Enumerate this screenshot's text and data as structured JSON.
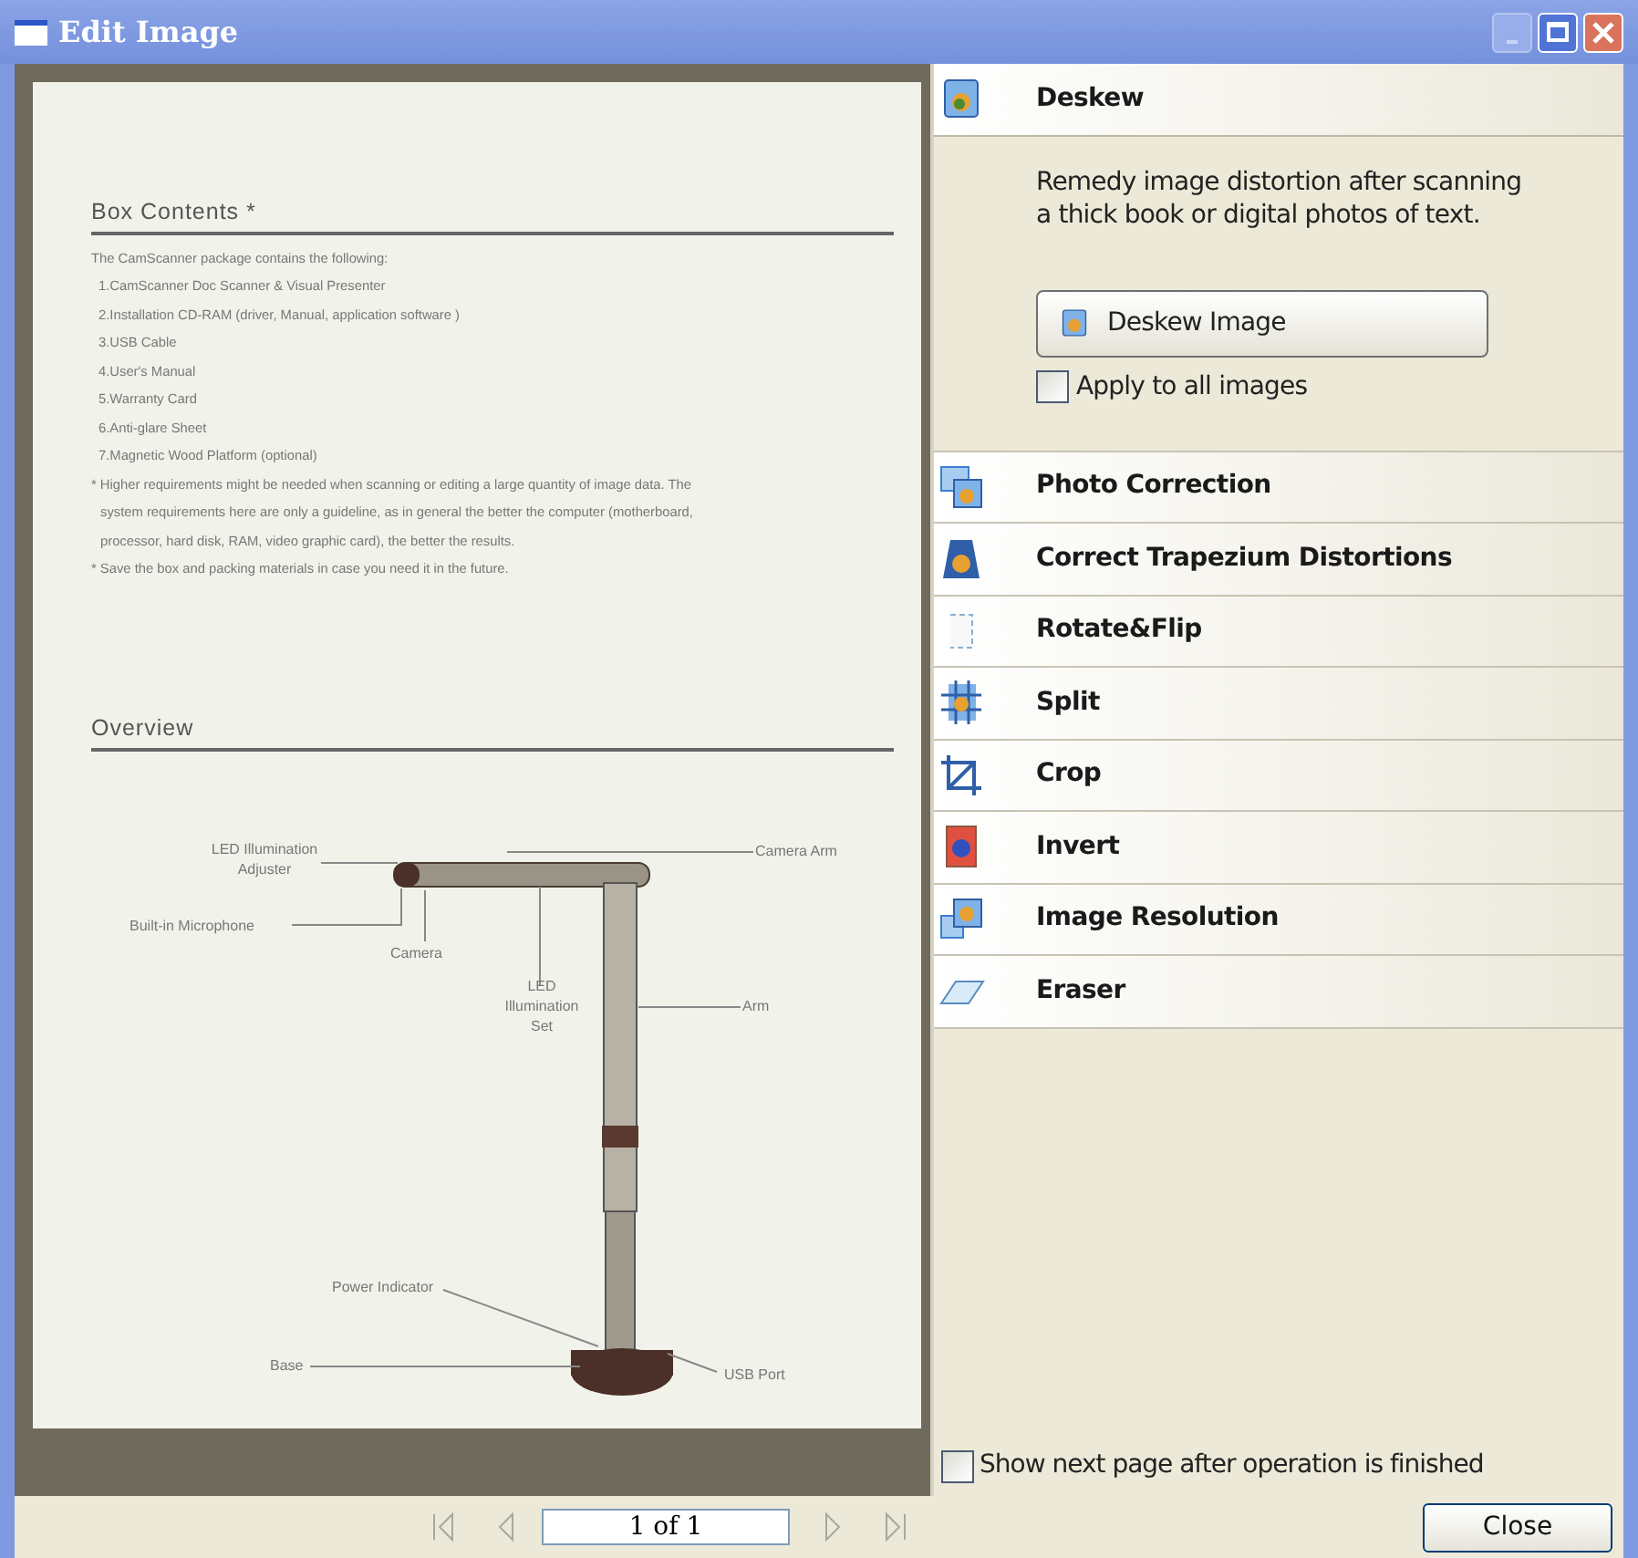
{
  "window": {
    "title": "Edit Image"
  },
  "document": {
    "sections": [
      {
        "heading": "Box Contents *",
        "lines": [
          "The CamScanner package contains the following:",
          "1.CamScanner Doc Scanner & Visual Presenter",
          "2.Installation CD-RAM (driver, Manual, application software )",
          "3.USB Cable",
          "4.User's Manual",
          "5.Warranty Card",
          "6.Anti-glare Sheet",
          "7.Magnetic Wood Platform (optional)",
          "* Higher requirements might be needed when scanning or editing a large quantity of image data. The",
          "system requirements here are only a guideline, as in general the better the computer (motherboard,",
          "processor, hard disk, RAM, video graphic card), the better the results.",
          "* Save the box and packing materials in case you need it in the future."
        ]
      },
      {
        "heading": "Overview"
      }
    ],
    "diagram_labels": [
      "LED Illumination Adjuster",
      "Camera Arm",
      "Built-in Microphone",
      "Camera",
      "LED Illumination Set",
      "Arm",
      "Power Indicator",
      "Base",
      "USB Port"
    ]
  },
  "tools": [
    {
      "label": "Deskew",
      "expanded": true,
      "description": "Remedy image distortion after scanning a thick book or digital photos of text.",
      "action": "Deskew Image",
      "apply_all": {
        "label": "Apply to all images",
        "checked": false
      }
    },
    {
      "label": "Photo Correction",
      "expanded": false
    },
    {
      "label": "Correct Trapezium Distortions",
      "expanded": false
    },
    {
      "label": "Rotate&Flip",
      "expanded": false
    },
    {
      "label": "Split",
      "expanded": false
    },
    {
      "label": "Crop",
      "expanded": false
    },
    {
      "label": "Invert",
      "expanded": false
    },
    {
      "label": "Image Resolution",
      "expanded": false
    },
    {
      "label": "Eraser",
      "expanded": false
    }
  ],
  "show_next": {
    "label": "Show next page after operation is finished",
    "checked": false
  },
  "pager": {
    "value": "1 of 1"
  },
  "buttons": [
    "Close"
  ]
}
